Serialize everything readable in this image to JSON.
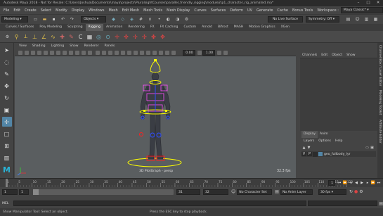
{
  "titlebar": {
    "title": "Autodesk Maya 2018 - Not for Resale: C:\\Users\\Joshua\\Documents\\maya\\projects\\PluralsightCourses\\parallel_friendly_rigging\\module2\\p1_character_rig_animated.ma*"
  },
  "menubar": {
    "items": [
      "File",
      "Edit",
      "Create",
      "Select",
      "Modify",
      "Display",
      "Windows",
      "Mesh",
      "Edit Mesh",
      "Mesh Tools",
      "Mesh Display",
      "Curves",
      "Surfaces",
      "Deform",
      "UV",
      "Generate",
      "Cache",
      "Bonus Tools"
    ],
    "workspace_label": "Workspace :",
    "workspace_value": "Maya Classic*"
  },
  "statusline": {
    "mode": "Modeling",
    "objects": "Objects",
    "live_surface": "No Live Surface",
    "symmetry": "Symmetry: Off"
  },
  "shelf": {
    "tabs": [
      "Curves / Surfaces",
      "Poly Modeling",
      "Sculpting",
      "Rigging",
      "Animation",
      "Rendering",
      "FX",
      "FX Caching",
      "Custom",
      "Arnold",
      "Bifrost",
      "MASH",
      "Motion Graphics",
      "XGen"
    ],
    "active_tab": "Rigging"
  },
  "viewport": {
    "menus": [
      "View",
      "Shading",
      "Lighting",
      "Show",
      "Renderer",
      "Panels"
    ],
    "exposure": "0.00",
    "gamma": "1.00",
    "camera_label": "3D PlotGraph - persp",
    "fps": "32.3 fps"
  },
  "channelbox": {
    "menus": [
      "Channels",
      "Edit",
      "Object",
      "Show"
    ]
  },
  "layers": {
    "tabs": [
      "Display",
      "Anim"
    ],
    "menus": [
      "Layers",
      "Options",
      "Help"
    ],
    "layer_flags": [
      "V",
      "P"
    ],
    "layer_name": "geo_fullbody_lyr"
  },
  "sidetabs": [
    "Channel Box / Layer Editor",
    "Modeling Toolkit",
    "Attribute Editor"
  ],
  "timeline": {
    "ticks": [
      "1",
      "5",
      "10",
      "15",
      "20",
      "25",
      "30",
      "35",
      "40",
      "45",
      "50",
      "55",
      "60",
      "65",
      "70",
      "75",
      "80",
      "85",
      "90",
      "95",
      "100",
      "105",
      "110",
      "115",
      "120"
    ],
    "current_frame": "1"
  },
  "range": {
    "start": "1",
    "min": "1",
    "max": "31",
    "end": "32",
    "character_set": "No Character Set",
    "anim_layer": "No Anim Layer",
    "fps": "30 fps"
  },
  "cmdline": {
    "lang": "MEL"
  },
  "helpline": {
    "left": "Show Manipulator Tool: Select an object.",
    "center": "Press the ESC key to stop playback."
  },
  "colors": {
    "accent": "#5285a6",
    "joint_blue": "#2e4dff",
    "control_yellow": "#ffff00",
    "control_red": "#ff2020"
  }
}
